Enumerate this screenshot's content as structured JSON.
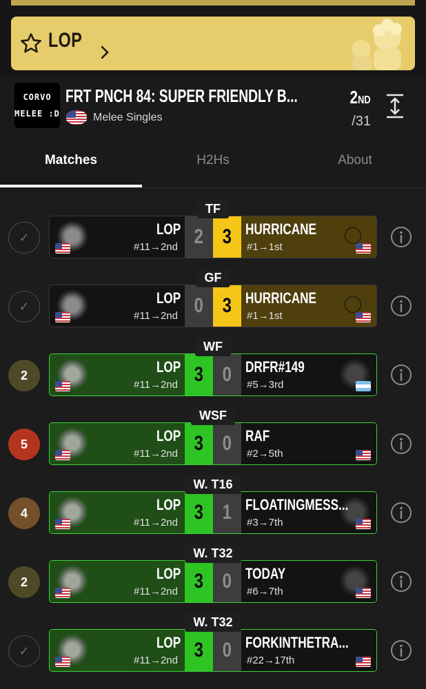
{
  "player": {
    "name": "LOP"
  },
  "event": {
    "logo_line1": "CORVO",
    "logo_line2": "MELEE :D",
    "title": "FRT PNCH 84:  SUPER FRIENDLY B...",
    "game": "Melee Singles",
    "placement": "2",
    "placement_suffix": "ND",
    "total": "/31"
  },
  "tabs": [
    {
      "label": "Matches",
      "active": true
    },
    {
      "label": "H2Hs",
      "active": false
    },
    {
      "label": "About",
      "active": false
    }
  ],
  "colors": {
    "win_green": "#2ec424",
    "win_gold": "#f5c518",
    "banner_gold": "#e7cc6b"
  },
  "matches": [
    {
      "round": "TF",
      "status": "✓",
      "status_type": "check",
      "result": "loss",
      "left_name": "LOP",
      "left_seed": "#11→2nd",
      "left_score": "2",
      "right_name": "HURRICANE",
      "right_seed": "#1→1st",
      "right_score": "3",
      "right_flag": "us",
      "right_avatar": "ring"
    },
    {
      "round": "GF",
      "status": "✓",
      "status_type": "check",
      "result": "loss",
      "left_name": "LOP",
      "left_seed": "#11→2nd",
      "left_score": "0",
      "right_name": "HURRICANE",
      "right_seed": "#1→1st",
      "right_score": "3",
      "right_flag": "us",
      "right_avatar": "ring"
    },
    {
      "round": "WF",
      "status": "2",
      "status_type": "#4e4a28",
      "result": "win",
      "left_name": "LOP",
      "left_seed": "#11→2nd",
      "left_score": "3",
      "right_name": "DRFR#149",
      "right_seed": "#5→3rd",
      "right_score": "0",
      "right_flag": "ar",
      "right_avatar": "dark"
    },
    {
      "round": "WSF",
      "status": "5",
      "status_type": "#b4351e",
      "result": "win",
      "left_name": "LOP",
      "left_seed": "#11→2nd",
      "left_score": "3",
      "right_name": "RAF",
      "right_seed": "#2→5th",
      "right_score": "0",
      "right_flag": "us",
      "right_avatar": "ring"
    },
    {
      "round": "W. T16",
      "status": "4",
      "status_type": "#74502a",
      "result": "win",
      "left_name": "LOP",
      "left_seed": "#11→2nd",
      "left_score": "3",
      "right_name": "FLOATINGMESS...",
      "right_seed": "#3→7th",
      "right_score": "1",
      "right_flag": "us",
      "right_avatar": "dark"
    },
    {
      "round": "W. T32",
      "status": "2",
      "status_type": "#4e4a28",
      "result": "win",
      "left_name": "LOP",
      "left_seed": "#11→2nd",
      "left_score": "3",
      "right_name": "TODAY",
      "right_seed": "#6→7th",
      "right_score": "0",
      "right_flag": "us",
      "right_avatar": "dark"
    },
    {
      "round": "W. T32",
      "status": "✓",
      "status_type": "check",
      "result": "win",
      "left_name": "LOP",
      "left_seed": "#11→2nd",
      "left_score": "3",
      "right_name": "FORKINTHETRA...",
      "right_seed": "#22→17th",
      "right_score": "0",
      "right_flag": "us",
      "right_avatar": "ring"
    }
  ],
  "icons": {
    "banner": "star-icon",
    "chevron": "chevron-right-icon",
    "expand": "expand-vertical-icon",
    "info": "info-icon"
  }
}
